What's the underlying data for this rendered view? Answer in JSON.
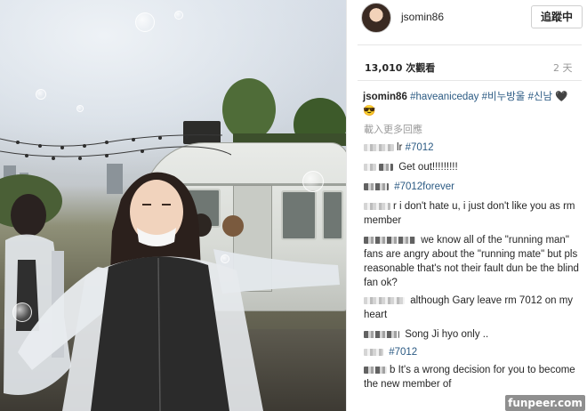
{
  "photo": {
    "description_icon": "photo-image"
  },
  "post": {
    "username": "jsomin86",
    "follow_label": "追蹤中",
    "views": "13,010 次觀看",
    "age": "2 天",
    "caption_user": "jsomin86",
    "caption_tags": [
      "#haveaniceday",
      "#비누방울",
      "#신남"
    ],
    "caption_emoji": "🖤😎",
    "load_more": "載入更多回應"
  },
  "comments": [
    {
      "user_visible": "lr",
      "text": "",
      "tag": "#7012"
    },
    {
      "user_visible": "",
      "text": "Get out!!!!!!!!!",
      "tag": ""
    },
    {
      "user_visible": "",
      "text": "",
      "tag": "#7012forever"
    },
    {
      "user_visible": "r",
      "text": "i don't hate u, i just don't like you as rm member",
      "tag": ""
    },
    {
      "user_visible": "",
      "text": "we know all of the \"running man\" fans are angry about the \"running mate\" but pls reasonable that's not their fault dun be the blind fan ok?",
      "tag": ""
    },
    {
      "user_visible": "",
      "text": "although Gary leave rm 7012 on my heart",
      "tag": ""
    },
    {
      "user_visible": "",
      "text": "Song Ji hyo only ..",
      "tag": ""
    },
    {
      "user_visible": "",
      "text": "",
      "tag": "#7012"
    },
    {
      "user_visible": "b",
      "text": "It's a wrong decision for you to become the new member of",
      "tag": ""
    }
  ],
  "watermark": "funpeer.com",
  "colors": {
    "hashtag": "#2b5a83",
    "muted": "#999999",
    "text": "#262626",
    "watermark_bg": "#8f8f8f"
  }
}
